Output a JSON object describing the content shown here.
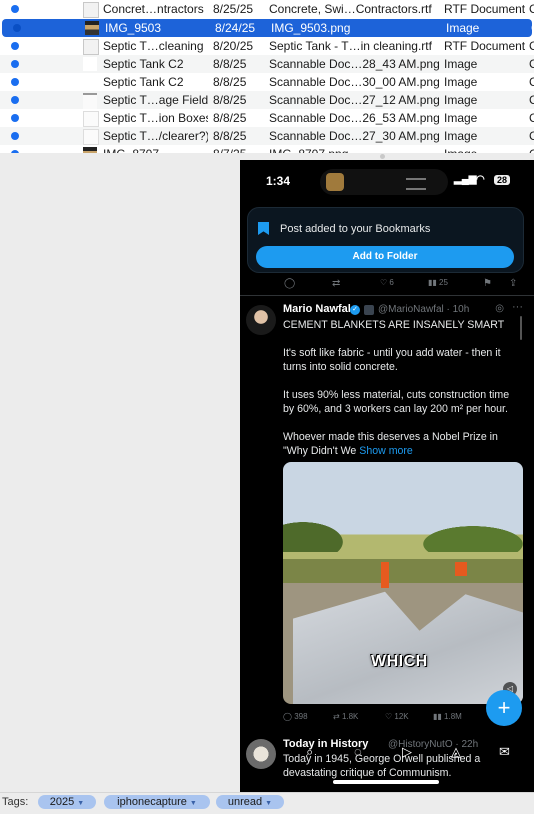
{
  "files": [
    {
      "name": "Concret…ntractors",
      "date": "8/25/25",
      "file": "Concrete, Swi…Contractors.rtf",
      "kind": "RTF Document",
      "more": "C",
      "thumb": "doc",
      "cut": true
    },
    {
      "name": "IMG_9503",
      "date": "8/24/25",
      "file": "IMG_9503.png",
      "kind": "Image",
      "more": "C",
      "thumb": "photo",
      "selected": true
    },
    {
      "name": "Septic T…cleaning",
      "date": "8/20/25",
      "file": "Septic Tank - T…in cleaning.rtf",
      "kind": "RTF Document",
      "more": "C",
      "thumb": "doc"
    },
    {
      "name": "Septic Tank C2",
      "date": "8/8/25",
      "file": "Scannable Doc…28_43 AM.png",
      "kind": "Image",
      "more": "C",
      "thumb": "blank"
    },
    {
      "name": "Septic Tank C2",
      "date": "8/8/25",
      "file": "Scannable Doc…30_00 AM.png",
      "kind": "Image",
      "more": "C",
      "thumb": "blank"
    },
    {
      "name": "Septic T…age Field",
      "date": "8/8/25",
      "file": "Scannable Doc…27_12 AM.png",
      "kind": "Image",
      "more": "C",
      "thumb": "sketch"
    },
    {
      "name": "Septic T…ion Boxes",
      "date": "8/8/25",
      "file": "Scannable Doc…26_53 AM.png",
      "kind": "Image",
      "more": "C",
      "thumb": "page"
    },
    {
      "name": "Septic T…/clearer?)",
      "date": "8/8/25",
      "file": "Scannable Doc…27_30 AM.png",
      "kind": "Image",
      "more": "C",
      "thumb": "page"
    },
    {
      "name": "IMG_8707",
      "date": "8/7/25",
      "file": "IMG_8707.png",
      "kind": "Image",
      "more": "C",
      "thumb": "photo"
    }
  ],
  "phone": {
    "status": {
      "time": "1:34",
      "battery": "28"
    },
    "toast": {
      "message": "Post added to your Bookmarks",
      "button": "Add to Folder"
    },
    "prev_actions": {
      "likes": "6",
      "views": "25"
    },
    "tweet": {
      "author": "Mario Nawfal",
      "handle": "@MarioNawfal · 10h",
      "paragraphs": [
        "CEMENT BLANKETS ARE INSANELY SMART",
        "It's soft like fabric - until you add water - then it turns into solid concrete.",
        "It uses 90% less material, cuts construction time by 60%, and 3 workers can lay 200 m² per hour."
      ],
      "last_line": "Whoever made this deserves a Nobel Prize in \"Why Didn't We",
      "show_more": "Show more",
      "caption": "WHICH",
      "actions": {
        "replies": "398",
        "reposts": "1.8K",
        "likes": "12K",
        "views": "1.8M"
      }
    },
    "next_tweet": {
      "author": "Today in History",
      "handle": "@HistoryNutO · 22h",
      "text": "Today in 1945, George Orwell published a devastating critique of Communism."
    }
  },
  "tags": {
    "label": "Tags:",
    "items": [
      "2025",
      "iphonecapture",
      "unread"
    ]
  },
  "colors": {
    "selection": "#1d63d9",
    "unread_dot": "#1a6ef0",
    "tag": "#a9c4ef",
    "x_blue": "#1d9bf0"
  }
}
